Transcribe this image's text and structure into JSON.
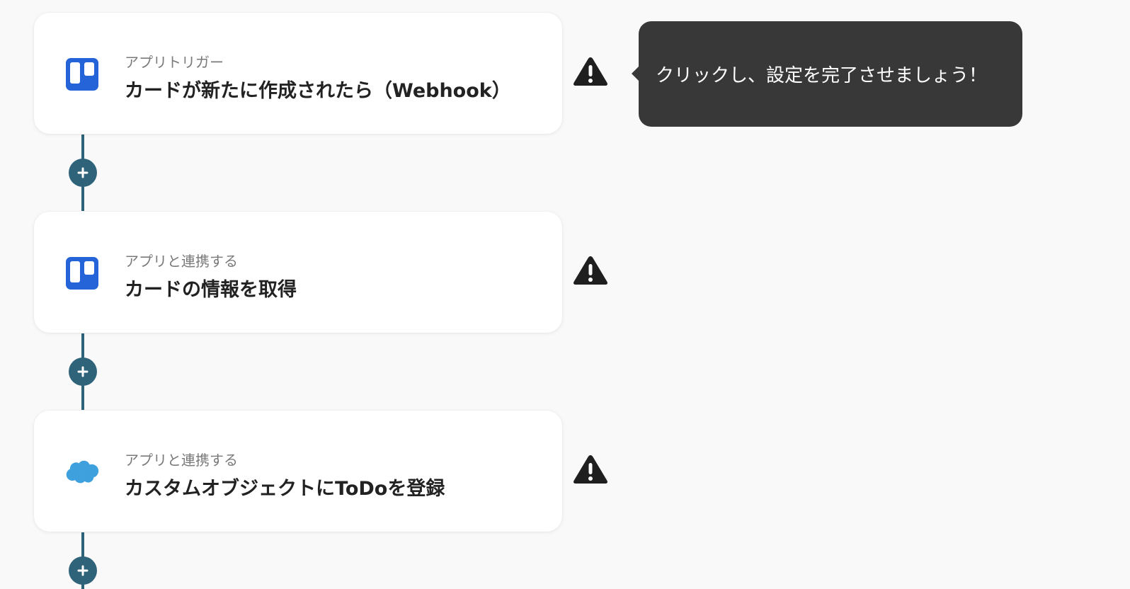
{
  "flow": {
    "steps": [
      {
        "type_label": "アプリトリガー",
        "title": "カードが新たに作成されたら（Webhook）",
        "app_icon": "trello-icon"
      },
      {
        "type_label": "アプリと連携する",
        "title": "カードの情報を取得",
        "app_icon": "trello-icon"
      },
      {
        "type_label": "アプリと連携する",
        "title": "カスタムオブジェクトにToDoを登録",
        "app_icon": "salesforce-icon"
      }
    ],
    "add_button_icon": "plus-icon",
    "warning_icon": "warning-icon"
  },
  "tooltip": {
    "text": "クリックし、設定を完了させましょう！"
  },
  "colors": {
    "background": "#f9f9f9",
    "connector": "#2e6379",
    "trello_blue": "#2563d9",
    "salesforce_blue": "#3ea1dd",
    "tooltip_bg": "#383838",
    "warning": "#1f1f1f"
  }
}
